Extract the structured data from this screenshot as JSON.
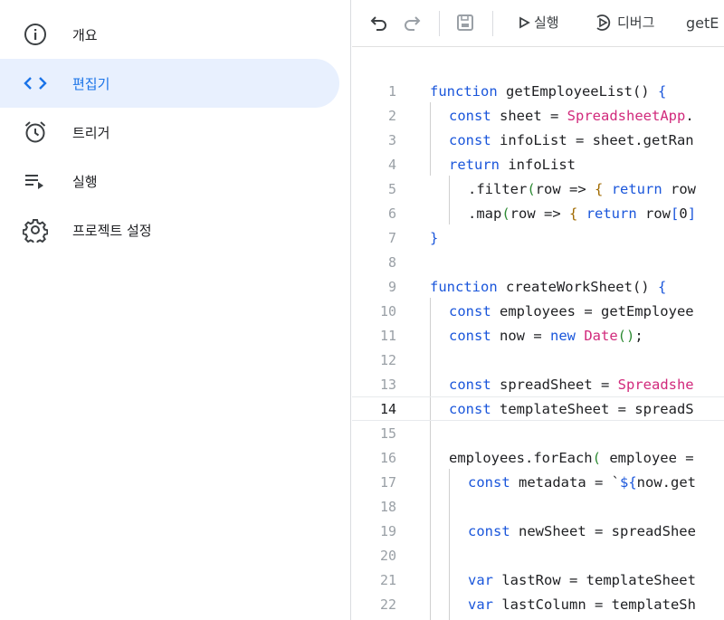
{
  "sidebar": {
    "items": [
      {
        "label": "개요",
        "icon": "info-icon",
        "active": false
      },
      {
        "label": "편집기",
        "icon": "code-icon",
        "active": true
      },
      {
        "label": "트리거",
        "icon": "alarm-clock-icon",
        "active": false
      },
      {
        "label": "실행",
        "icon": "playlist-play-icon",
        "active": false
      },
      {
        "label": "프로젝트 설정",
        "icon": "gear-icon",
        "active": false
      }
    ]
  },
  "toolbar": {
    "run_label": "실행",
    "debug_label": "디버그",
    "function_selected": "getE"
  },
  "colors": {
    "accent": "#1a73e8",
    "active_bg": "#e8f0fe",
    "keyword": "#1a56db",
    "identifier_pink": "#d12a7c"
  },
  "editor": {
    "current_line": 14,
    "lines": [
      {
        "n": "1",
        "text": "function getEmployeeList() {"
      },
      {
        "n": "2",
        "text": "const sheet = SpreadsheetApp."
      },
      {
        "n": "3",
        "text": "const infoList = sheet.getRan"
      },
      {
        "n": "4",
        "text": "return infoList"
      },
      {
        "n": "5",
        "text": ".filter(row => { return row"
      },
      {
        "n": "6",
        "text": ".map(row => { return row[0]"
      },
      {
        "n": "7",
        "text": "}"
      },
      {
        "n": "8",
        "text": ""
      },
      {
        "n": "9",
        "text": "function createWorkSheet() {"
      },
      {
        "n": "10",
        "text": "const employees = getEmployee"
      },
      {
        "n": "11",
        "text": "const now = new Date();"
      },
      {
        "n": "12",
        "text": ""
      },
      {
        "n": "13",
        "text": "const spreadSheet = Spreadshe"
      },
      {
        "n": "14",
        "text": "const templateSheet = spreadS"
      },
      {
        "n": "15",
        "text": ""
      },
      {
        "n": "16",
        "text": "employees.forEach( employee ="
      },
      {
        "n": "17",
        "text": "const metadata = `${now.get"
      },
      {
        "n": "18",
        "text": ""
      },
      {
        "n": "19",
        "text": "const newSheet = spreadShee"
      },
      {
        "n": "20",
        "text": ""
      },
      {
        "n": "21",
        "text": "var lastRow = templateSheet"
      },
      {
        "n": "22",
        "text": "var lastColumn = templateSh"
      }
    ]
  }
}
